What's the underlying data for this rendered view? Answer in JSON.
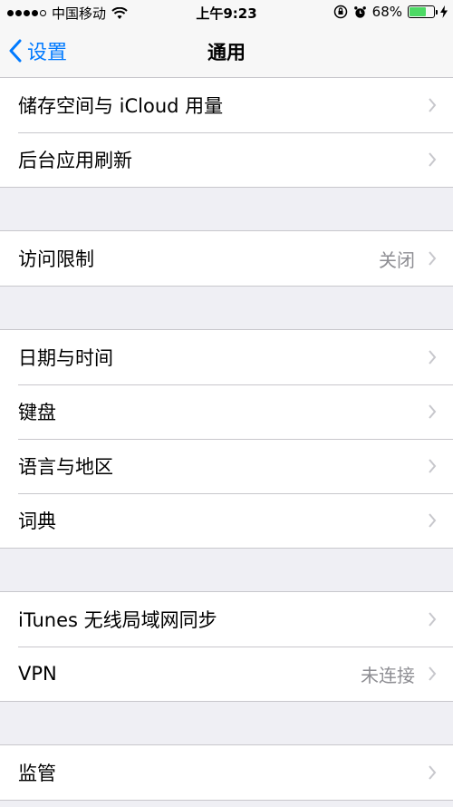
{
  "status_bar": {
    "carrier": "中国移动",
    "time": "上午9:23",
    "battery_percent": "68%",
    "battery_level": 0.68,
    "signal_bars_filled": 4,
    "signal_bars_total": 5
  },
  "nav": {
    "back_label": "设置",
    "title": "通用"
  },
  "groups": [
    {
      "rows": [
        {
          "label": "储存空间与 iCloud 用量",
          "value": ""
        },
        {
          "label": "后台应用刷新",
          "value": ""
        }
      ]
    },
    {
      "rows": [
        {
          "label": "访问限制",
          "value": "关闭"
        }
      ]
    },
    {
      "rows": [
        {
          "label": "日期与时间",
          "value": ""
        },
        {
          "label": "键盘",
          "value": ""
        },
        {
          "label": "语言与地区",
          "value": ""
        },
        {
          "label": "词典",
          "value": ""
        }
      ]
    },
    {
      "rows": [
        {
          "label": "iTunes 无线局域网同步",
          "value": ""
        },
        {
          "label": "VPN",
          "value": "未连接"
        }
      ]
    },
    {
      "rows": [
        {
          "label": "监管",
          "value": ""
        }
      ]
    }
  ],
  "colors": {
    "accent": "#007aff",
    "background": "#efeff4",
    "separator": "#c8c7cc",
    "secondary_text": "#8e8e93",
    "battery": "#4cd964"
  }
}
